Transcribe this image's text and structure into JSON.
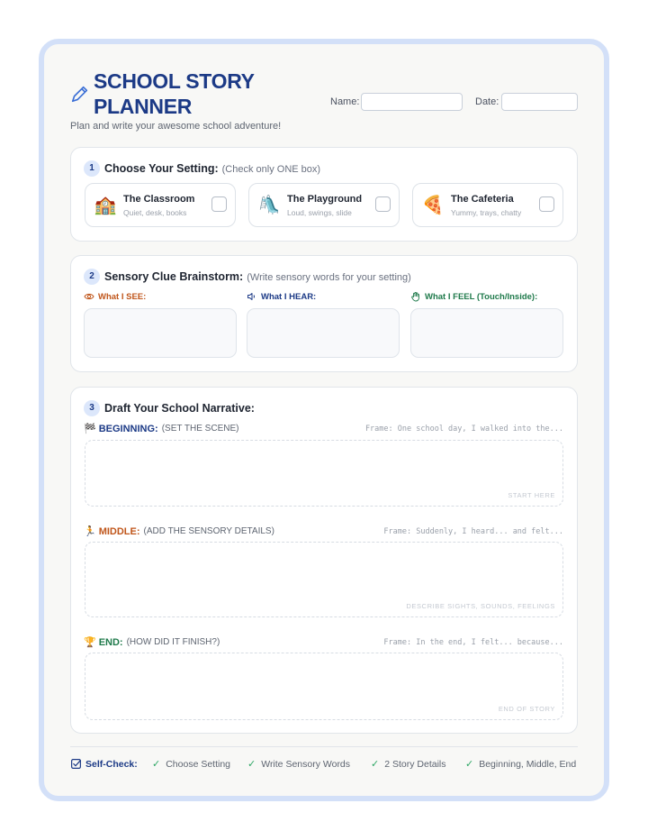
{
  "header": {
    "title": "SCHOOL STORY PLANNER",
    "subtitle": "Plan and write your awesome school adventure!",
    "name_label": "Name:",
    "date_label": "Date:",
    "name_value": "",
    "date_value": ""
  },
  "setting": {
    "number": "1",
    "title": "Choose Your Setting:",
    "hint": "(Check only ONE box)",
    "options": [
      {
        "emoji": "🏫",
        "name": "The Classroom",
        "desc": "Quiet, desk, books",
        "checked": false
      },
      {
        "emoji": "🛝",
        "name": "The Playground",
        "desc": "Loud, swings, slide",
        "checked": false
      },
      {
        "emoji": "🍕",
        "name": "The Cafeteria",
        "desc": "Yummy, trays, chatty",
        "checked": false
      }
    ]
  },
  "sensory": {
    "number": "2",
    "title": "Sensory Clue Brainstorm:",
    "hint": "(Write sensory words for your setting)",
    "columns": [
      {
        "label": "What I SEE:",
        "icon": "eye-icon",
        "color": "#c0561b"
      },
      {
        "label": "What I HEAR:",
        "icon": "speaker-icon",
        "color": "#1c3a86"
      },
      {
        "label": "What I FEEL (Touch/Inside):",
        "icon": "hand-icon",
        "color": "#1f7a4b"
      }
    ]
  },
  "narrative": {
    "number": "3",
    "title": "Draft Your School Narrative:",
    "parts": [
      {
        "emoji": "🏁",
        "head": "BEGINNING:",
        "sub": "(SET THE SCENE)",
        "frame": "Frame: One school day, I walked into the...",
        "hint": "START HERE",
        "color": "#1c3a86"
      },
      {
        "emoji": "🏃",
        "head": "MIDDLE:",
        "sub": "(ADD THE SENSORY DETAILS)",
        "frame": "Frame: Suddenly, I heard... and felt...",
        "hint": "DESCRIBE SIGHTS, SOUNDS, FEELINGS",
        "color": "#c0561b"
      },
      {
        "emoji": "🏆",
        "head": "END:",
        "sub": "(HOW DID IT FINISH?)",
        "frame": "Frame: In the end, I felt... because...",
        "hint": "END OF STORY",
        "color": "#1f7a4b"
      }
    ]
  },
  "self_check": {
    "label": "Self-Check:",
    "items": [
      "Choose Setting",
      "Write Sensory Words",
      "2 Story Details",
      "Beginning, Middle, End"
    ]
  },
  "colors": {
    "primary": "#1c3a86",
    "see": "#c0561b",
    "hear": "#1c3a86",
    "feel": "#1f7a4b",
    "check": "#2fa866",
    "frame_border": "#d3e0f8"
  }
}
